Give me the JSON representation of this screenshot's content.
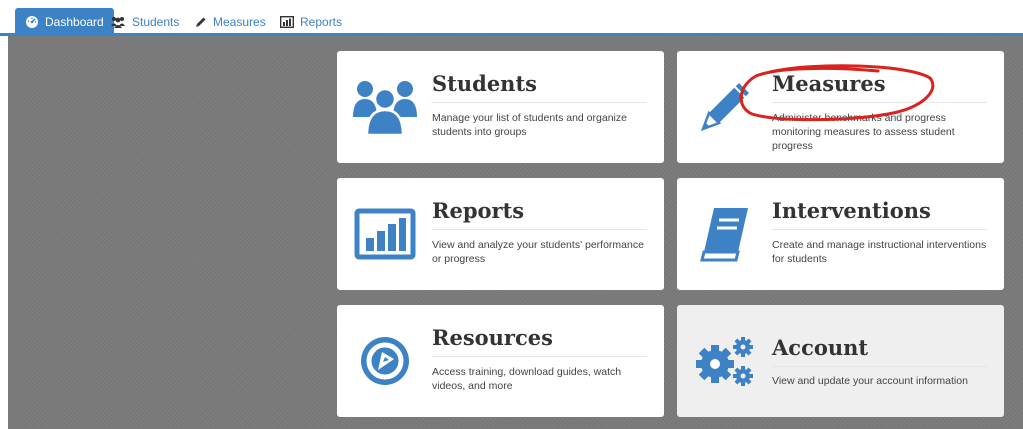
{
  "nav": {
    "tabs": [
      {
        "label": "Dashboard",
        "icon": "dashboard-gauge-icon",
        "active": true
      },
      {
        "label": "Students",
        "icon": "users-icon",
        "active": false
      },
      {
        "label": "Measures",
        "icon": "pencil-icon",
        "active": false
      },
      {
        "label": "Reports",
        "icon": "bar-chart-icon",
        "active": false
      }
    ]
  },
  "cards": [
    {
      "title": "Students",
      "desc": "Manage your list of students and organize students into groups",
      "icon": "students-group-icon"
    },
    {
      "title": "Measures",
      "desc": "Administer benchmarks and progress monitoring measures to assess student progress",
      "icon": "pencil-icon"
    },
    {
      "title": "Reports",
      "desc": "View and analyze your students' performance or progress",
      "icon": "bar-chart-icon"
    },
    {
      "title": "Interventions",
      "desc": "Create and manage instructional interventions for students",
      "icon": "book-icon"
    },
    {
      "title": "Resources",
      "desc": "Access training, download guides, watch videos, and more",
      "icon": "play-compass-icon"
    },
    {
      "title": "Account",
      "desc": "View and update your account information",
      "icon": "gears-icon"
    }
  ],
  "colors": {
    "accent": "#3e82c6",
    "annotation": "#d9231f",
    "background": "#7a7a7a"
  }
}
